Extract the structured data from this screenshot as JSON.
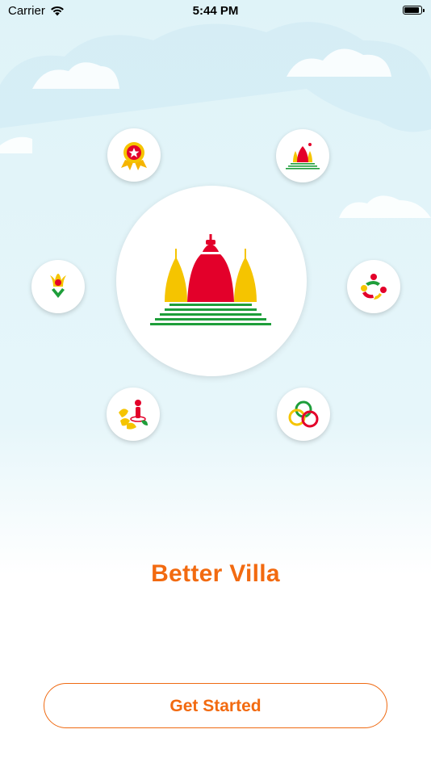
{
  "status_bar": {
    "carrier": "Carrier",
    "time": "5:44 PM"
  },
  "app": {
    "title": "Better Villa"
  },
  "actions": {
    "get_started_label": "Get Started"
  },
  "icons": [
    {
      "name": "award-ribbon-icon"
    },
    {
      "name": "temple-small-icon"
    },
    {
      "name": "tulip-flower-icon"
    },
    {
      "name": "community-people-icon"
    },
    {
      "name": "produce-person-icon"
    },
    {
      "name": "interlocking-rings-icon"
    },
    {
      "name": "temple-logo-icon"
    }
  ],
  "colors": {
    "accent": "#f26a10",
    "temple_red": "#e3002a",
    "temple_yellow": "#f5c400",
    "temple_green": "#1e9e3a",
    "sky": "#e0f4f9"
  }
}
